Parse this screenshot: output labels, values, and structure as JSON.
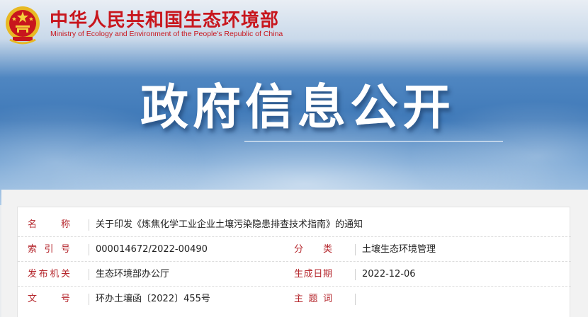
{
  "header": {
    "org_name_cn": "中华人民共和国生态环境部",
    "org_name_en": "Ministry of Ecology and Environment of the People's Republic of China",
    "emblem_icon": "national-emblem-icon",
    "brand_color": "#c8161d"
  },
  "banner": {
    "title": "政府信息公开"
  },
  "document_info": {
    "title_label": "名　称",
    "title_value": "关于印发《炼焦化学工业企业土壤污染隐患排查技术指南》的通知",
    "index_label": "索引号",
    "index_value": "000014672/2022-00490",
    "category_label": "分　类",
    "category_value": "土壤生态环境管理",
    "issuer_label": "发布机关",
    "issuer_value": "生态环境部办公厅",
    "date_label": "生成日期",
    "date_value": "2022-12-06",
    "doc_number_label": "文　号",
    "doc_number_value": "环办土壤函〔2022〕455号",
    "keywords_label": "主题词",
    "keywords_value": ""
  },
  "colors": {
    "label": "#b5272d",
    "value": "#222222"
  }
}
